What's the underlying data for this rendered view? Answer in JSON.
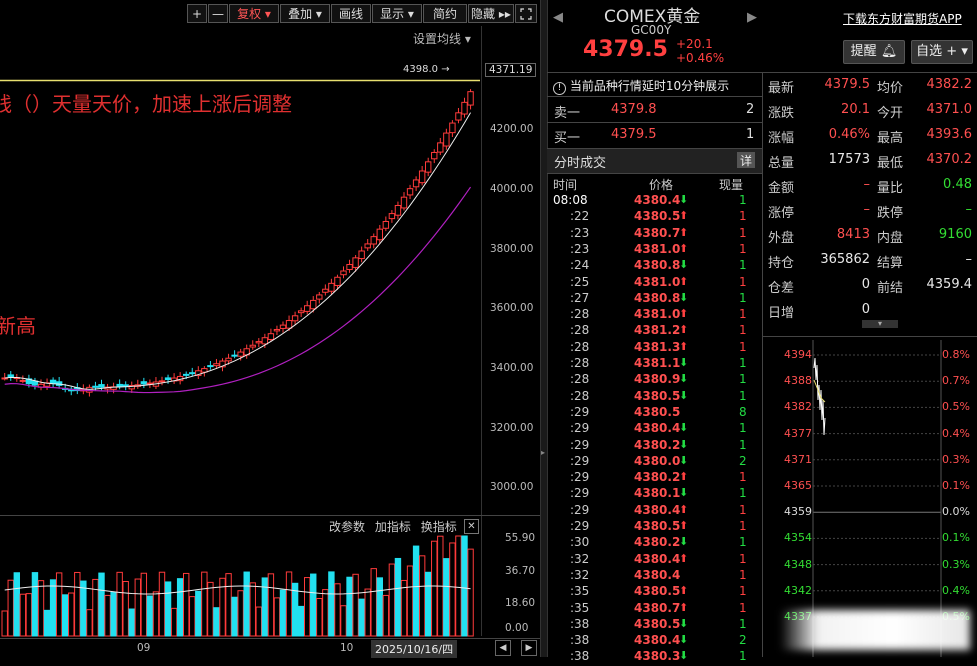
{
  "toolbar": {
    "plus": "+",
    "minus": "—",
    "fuquan": "复权",
    "diejia": "叠加",
    "huaxian": "画线",
    "xianshi": "显示",
    "jianyue": "简约",
    "yincang": "隐藏",
    "set_ma": "设置均线"
  },
  "chart": {
    "annot_main": "线（）天量天价，加速上涨后调整",
    "annot_left": "新高",
    "high_label": "4398.0",
    "current_price_tag": "4371.19",
    "yaxis": [
      "4200.00",
      "4000.00",
      "3800.00",
      "3600.00",
      "3400.00",
      "3200.00",
      "3000.00"
    ],
    "vol_tools": [
      "改参数",
      "加指标",
      "换指标"
    ],
    "vol_axis": [
      "55.90",
      "36.70",
      "18.60",
      "0.00"
    ],
    "xaxis": [
      "09",
      "10"
    ],
    "cursor_date": "2025/10/16/四"
  },
  "header": {
    "title": "COMEX黄金",
    "code": "GC00Y",
    "price": "4379.5",
    "change": "+20.1",
    "change_pct": "+0.46%",
    "app_link": "下载东方财富期货APP",
    "alert_btn": "提醒",
    "watch_btn": "自选"
  },
  "orderbook": {
    "delay_notice": "当前品种行情延时10分钟展示",
    "sell_label": "卖一",
    "sell_price": "4379.8",
    "sell_qty": "2",
    "buy_label": "买一",
    "buy_price": "4379.5",
    "buy_qty": "1"
  },
  "trades": {
    "title": "分时成交",
    "detail_btn": "详",
    "col_time": "时间",
    "col_price": "价格",
    "col_qty": "现量",
    "rows": [
      {
        "t": "08:08",
        "p": "4380.4",
        "d": "down",
        "q": "1"
      },
      {
        "t": ":22",
        "p": "4380.5",
        "d": "up",
        "q": "1"
      },
      {
        "t": ":23",
        "p": "4380.7",
        "d": "up",
        "q": "1"
      },
      {
        "t": ":23",
        "p": "4381.0",
        "d": "up",
        "q": "1"
      },
      {
        "t": ":24",
        "p": "4380.8",
        "d": "down",
        "q": "1"
      },
      {
        "t": ":25",
        "p": "4381.0",
        "d": "up",
        "q": "1"
      },
      {
        "t": ":27",
        "p": "4380.8",
        "d": "down",
        "q": "1"
      },
      {
        "t": ":28",
        "p": "4381.0",
        "d": "up",
        "q": "1"
      },
      {
        "t": ":28",
        "p": "4381.2",
        "d": "up",
        "q": "1"
      },
      {
        "t": ":28",
        "p": "4381.3",
        "d": "up",
        "q": "1"
      },
      {
        "t": ":28",
        "p": "4381.1",
        "d": "down",
        "q": "1"
      },
      {
        "t": ":28",
        "p": "4380.9",
        "d": "down",
        "q": "1"
      },
      {
        "t": ":28",
        "p": "4380.5",
        "d": "down",
        "q": "1"
      },
      {
        "t": ":29",
        "p": "4380.5",
        "d": "",
        "q": "8"
      },
      {
        "t": ":29",
        "p": "4380.4",
        "d": "down",
        "q": "1"
      },
      {
        "t": ":29",
        "p": "4380.2",
        "d": "down",
        "q": "1"
      },
      {
        "t": ":29",
        "p": "4380.0",
        "d": "down",
        "q": "2"
      },
      {
        "t": ":29",
        "p": "4380.2",
        "d": "up",
        "q": "1"
      },
      {
        "t": ":29",
        "p": "4380.1",
        "d": "down",
        "q": "1"
      },
      {
        "t": ":29",
        "p": "4380.4",
        "d": "up",
        "q": "1"
      },
      {
        "t": ":29",
        "p": "4380.5",
        "d": "up",
        "q": "1"
      },
      {
        "t": ":30",
        "p": "4380.2",
        "d": "down",
        "q": "1"
      },
      {
        "t": ":32",
        "p": "4380.4",
        "d": "up",
        "q": "1"
      },
      {
        "t": ":32",
        "p": "4380.4",
        "d": "",
        "q": "1"
      },
      {
        "t": ":35",
        "p": "4380.5",
        "d": "up",
        "q": "1"
      },
      {
        "t": ":35",
        "p": "4380.7",
        "d": "up",
        "q": "1"
      },
      {
        "t": ":38",
        "p": "4380.5",
        "d": "down",
        "q": "1"
      },
      {
        "t": ":38",
        "p": "4380.4",
        "d": "down",
        "q": "2"
      },
      {
        "t": ":38",
        "p": "4380.3",
        "d": "down",
        "q": "1"
      }
    ]
  },
  "quote": {
    "rows": [
      {
        "l1": "最新",
        "v1": "4379.5",
        "c1": "red",
        "l2": "均价",
        "v2": "4382.2",
        "c2": "red"
      },
      {
        "l1": "涨跌",
        "v1": "20.1",
        "c1": "red",
        "l2": "今开",
        "v2": "4371.0",
        "c2": "red"
      },
      {
        "l1": "涨幅",
        "v1": "0.46%",
        "c1": "red",
        "l2": "最高",
        "v2": "4393.6",
        "c2": "red"
      },
      {
        "l1": "总量",
        "v1": "17573",
        "c1": "white",
        "l2": "最低",
        "v2": "4370.2",
        "c2": "red"
      },
      {
        "l1": "金额",
        "v1": "–",
        "c1": "red",
        "l2": "量比",
        "v2": "0.48",
        "c2": "green"
      },
      {
        "l1": "涨停",
        "v1": "–",
        "c1": "red",
        "l2": "跌停",
        "v2": "–",
        "c2": "green"
      },
      {
        "l1": "外盘",
        "v1": "8413",
        "c1": "red",
        "l2": "内盘",
        "v2": "9160",
        "c2": "green"
      },
      {
        "l1": "持仓",
        "v1": "365862",
        "c1": "white",
        "l2": "结算",
        "v2": "–",
        "c2": "white"
      },
      {
        "l1": "仓差",
        "v1": "0",
        "c1": "white",
        "l2": "前结",
        "v2": "4359.4",
        "c2": "white"
      },
      {
        "l1": "日增",
        "v1": "0",
        "c1": "white",
        "l2": "",
        "v2": "",
        "c2": "white"
      }
    ]
  },
  "mini": {
    "left": [
      "4394",
      "4388",
      "4382",
      "4377",
      "4371",
      "4365",
      "4359",
      "4354",
      "4348",
      "4342",
      "4337"
    ],
    "right": [
      "0.8%",
      "0.7%",
      "0.5%",
      "0.4%",
      "0.3%",
      "0.1%",
      "0.0%",
      "0.1%",
      "0.3%",
      "0.4%",
      "0.5%"
    ]
  },
  "colors": {
    "up": "#ff3b3b",
    "down": "#22dd44",
    "accent": "#ffee66",
    "ma": "#b020c0"
  }
}
